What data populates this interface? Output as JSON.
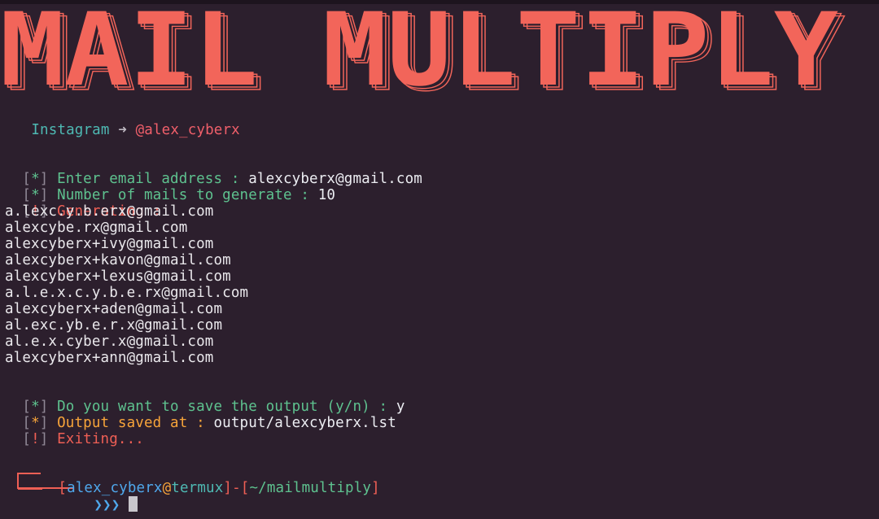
{
  "banner": {
    "text": "MAIL MULTIPLY",
    "fill": "#f2655a",
    "stroke": "#f2655a"
  },
  "credit": {
    "label": "Instagram",
    "arrow": "➜",
    "handle": "@alex_cyberx"
  },
  "session": {
    "line1": {
      "mark": "*",
      "prompt": "Enter email address : ",
      "value": "alexcyberx@gmail.com"
    },
    "line2": {
      "mark": "*",
      "prompt": "Number of mails to generate : ",
      "value": "10"
    },
    "line3": {
      "mark": "!",
      "prompt": "Generating :"
    },
    "emails": [
      "a.lexc.y.b.erx@gmail.com",
      "alexcybe.rx@gmail.com",
      "alexcyberx+ivy@gmail.com",
      "alexcyberx+kavon@gmail.com",
      "alexcyberx+lexus@gmail.com",
      "a.l.e.x.c.y.b.e.rx@gmail.com",
      "alexcyberx+aden@gmail.com",
      "al.exc.yb.e.r.x@gmail.com",
      "al.e.x.cyber.x@gmail.com",
      "alexcyberx+ann@gmail.com"
    ],
    "line4": {
      "mark": "*",
      "prompt": "Do you want to save the output (y/n) : ",
      "value": "y"
    },
    "line5": {
      "mark": "*",
      "prompt": "Output saved at : ",
      "value": "output/alexcyberx.lst"
    },
    "line6": {
      "mark": "!",
      "prompt": "Exiting..."
    }
  },
  "shell": {
    "user": "alex_cyberx",
    "at": "@",
    "host": "termux",
    "dash": "-",
    "path": "~/mailmultiply",
    "chevrons": "❯❯❯"
  },
  "colors": {
    "background": "#2c1f2d",
    "green": "#5ec28f",
    "red": "#ef5f55",
    "orange": "#f7a43a",
    "blue": "#4fa8ec",
    "teal": "#4eb9b3"
  }
}
